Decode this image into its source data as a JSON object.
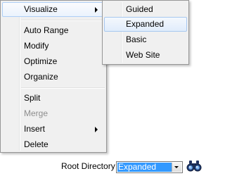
{
  "context_menu": {
    "items": [
      {
        "label": "Visualize",
        "has_submenu": true,
        "highlighted": true,
        "enabled": true
      },
      {
        "label": "Auto Range",
        "enabled": true
      },
      {
        "label": "Modify",
        "enabled": true
      },
      {
        "label": "Optimize",
        "enabled": true
      },
      {
        "label": "Organize",
        "enabled": true
      },
      {
        "label": "Split",
        "enabled": true
      },
      {
        "label": "Merge",
        "enabled": false
      },
      {
        "label": "Insert",
        "has_submenu": true,
        "enabled": true
      },
      {
        "label": "Delete",
        "enabled": true
      }
    ]
  },
  "submenu": {
    "items": [
      {
        "label": "Guided"
      },
      {
        "label": "Expanded",
        "selected": true
      },
      {
        "label": "Basic"
      },
      {
        "label": "Web Site"
      }
    ]
  },
  "toolbar": {
    "root_directory_label": "Root Directory",
    "combo_value": "Expanded",
    "find_icon": "binoculars-icon"
  },
  "colors": {
    "menu_background": "#f0f0f0",
    "highlight_border": "#aecff7",
    "selection_blue": "#3399ff",
    "disabled_text": "#8d8d8d"
  }
}
